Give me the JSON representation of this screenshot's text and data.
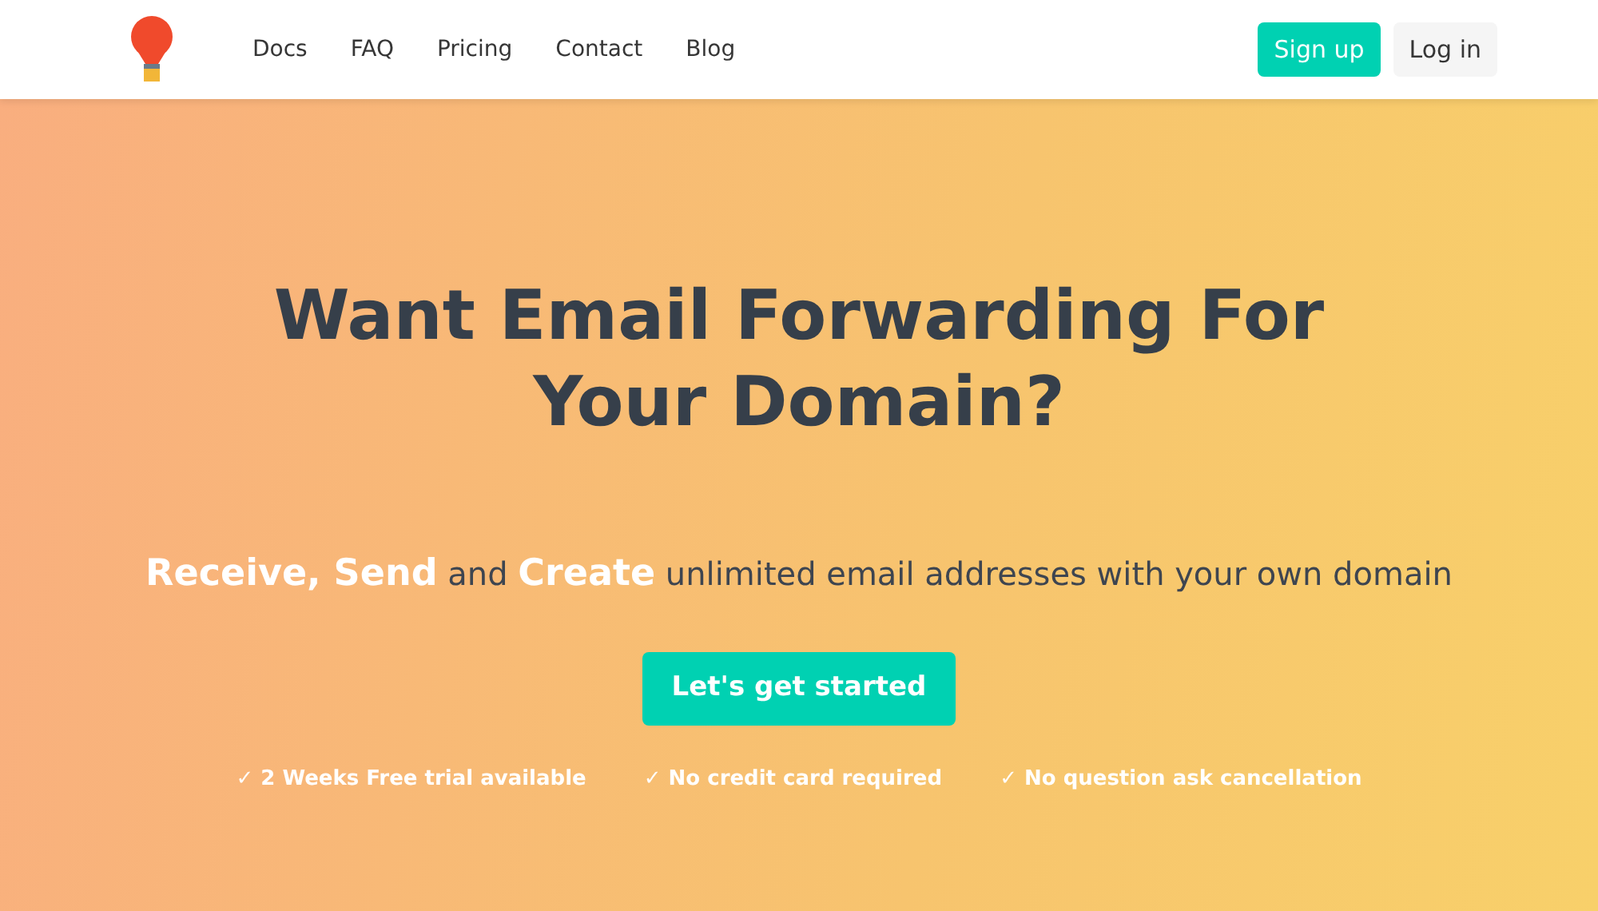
{
  "navbar": {
    "links": [
      "Docs",
      "FAQ",
      "Pricing",
      "Contact",
      "Blog"
    ],
    "buttons": [
      {
        "label": "Sign up",
        "kind": "primary"
      },
      {
        "label": "Log in",
        "kind": "light"
      }
    ]
  },
  "hero": {
    "title": "Want Email Forwarding For Your Domain?",
    "tagline": "**Receive, Send** and **Create** unlimited email addresses with your own domain",
    "cta": "Let's get started",
    "features": [
      "✓ 2 Weeks Free trial available",
      "✓ No credit card required",
      "✓ No question ask cancellation"
    ]
  }
}
